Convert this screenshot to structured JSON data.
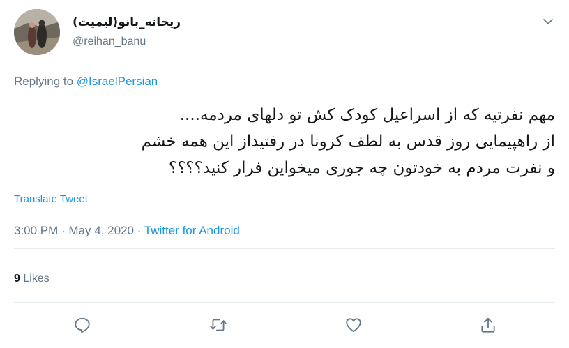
{
  "user": {
    "display_name": "ریحانه_بانو(لیمیت)",
    "handle": "@reihan_banu"
  },
  "reply": {
    "prefix": "Replying to ",
    "mention": "@IsraelPersian"
  },
  "tweet": {
    "lines": [
      "مهم نفرتیه که از اسراعیل کودک کش تو دلهای مردمه....",
      "از راهپیمایی روز قدس به لطف کرونا در رفتیداز این همه خشم",
      "و نفرت مردم به خودتون چه جوری میخواین فرار کنید؟؟؟؟"
    ]
  },
  "translate_label": "Translate Tweet",
  "meta": {
    "time": "3:00 PM",
    "sep1": " · ",
    "date": "May 4, 2020",
    "sep2": " · ",
    "source": "Twitter for Android"
  },
  "stats": {
    "likes_count": "9",
    "likes_label": "Likes"
  },
  "icons": {
    "more": "chevron-down-icon",
    "reply": "reply-icon",
    "retweet": "retweet-icon",
    "like": "heart-icon",
    "share": "share-icon"
  },
  "colors": {
    "link": "#1b95e0",
    "secondary_text": "#657786",
    "primary_text": "#14171a",
    "divider": "#e6ecf0",
    "icon": "#657786"
  }
}
